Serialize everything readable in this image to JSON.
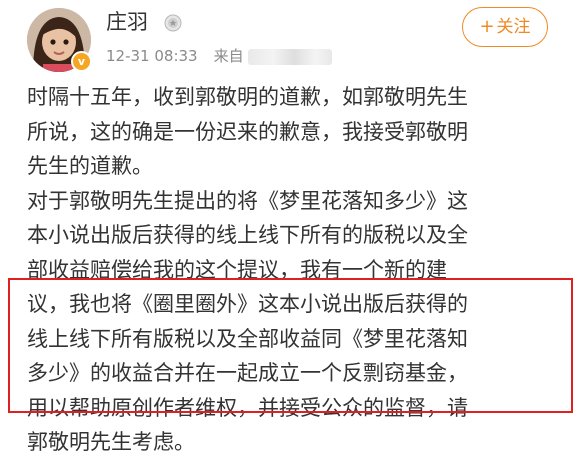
{
  "user": {
    "name": "庄羽",
    "medal_icon": "medal-icon",
    "avatar_icon": "avatar-photo",
    "verified_icon": "verified-badge-icon"
  },
  "meta": {
    "timestamp": "12-31 08:33",
    "source_label": "来自"
  },
  "follow_button": {
    "plus": "+",
    "label": "关注",
    "color": "#f08a24"
  },
  "post": {
    "lines": [
      "时隔十五年，收到郭敬明的道歉，如郭敬明先生",
      "所说，这的确是一份迟来的歉意，我接受郭敬明",
      "先生的道歉。",
      "对于郭敬明先生提出的将《梦里花落知多少》这",
      "本小说出版后获得的线上线下所有的版税以及全",
      "部收益赔偿给我的这个提议，我有一个新的建",
      "议，我也将《圈里圈外》这本小说出版后获得的",
      "线上线下所有版税以及全部收益同《梦里花落知",
      "多少》的收益合并在一起成立一个反剽窃基金，",
      "用以帮助原创作者维权，并接受公众的监督，请",
      "郭敬明先生考虑。"
    ]
  },
  "colors": {
    "highlight_border": "#e02020",
    "text": "#333333",
    "meta": "#8a8a8a"
  }
}
